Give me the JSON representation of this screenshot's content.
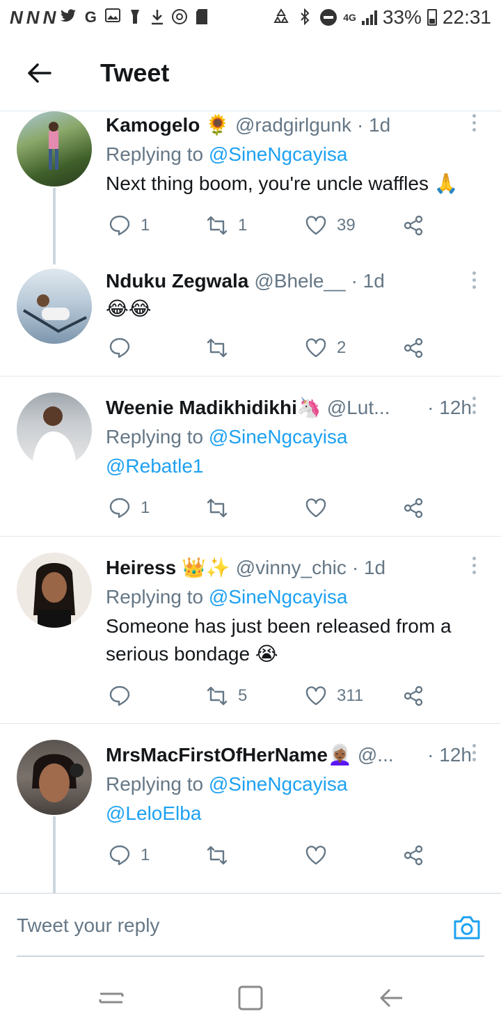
{
  "status_bar": {
    "left_glyphs": [
      "N",
      "N",
      "N"
    ],
    "network": "4G",
    "battery": "33%",
    "time": "22:31"
  },
  "header": {
    "title": "Tweet"
  },
  "tweets": [
    {
      "name": "Kamogelo 🌻",
      "handle": "@radgirlgunk",
      "time": "· 1d",
      "replying_label": "Replying to",
      "replying_to": "@SineNgcayisa",
      "text": "Next thing boom, you're uncle waffles 🙏",
      "replies": "1",
      "retweets": "1",
      "likes": "39"
    },
    {
      "name": "Nduku Zegwala",
      "handle": "@Bhele__",
      "time": "· 1d",
      "text": "😂😂",
      "replies": "",
      "retweets": "",
      "likes": "2"
    },
    {
      "name": "Weenie Madikhidikhi🦄",
      "handle": "@Lut...",
      "time": "· 12h",
      "replying_label": "Replying to",
      "replying_to": "@SineNgcayisa",
      "text": "@Rebatle1",
      "replies": "1",
      "retweets": "",
      "likes": ""
    },
    {
      "name": "Heiress 👑✨",
      "handle": "@vinny_chic",
      "time": "· 1d",
      "replying_label": "Replying to",
      "replying_to": "@SineNgcayisa",
      "text_line1": "Someone has just been released from a",
      "text_line2": "serious bondage 😭",
      "replies": "",
      "retweets": "5",
      "likes": "311"
    },
    {
      "name": "MrsMacFirstOfHerName👩🏾‍🦳",
      "handle": "@...",
      "time": "· 12h",
      "replying_label": "Replying to",
      "replying_to": "@SineNgcayisa",
      "text": "@LeloElba",
      "replies": "1",
      "retweets": "",
      "likes": ""
    }
  ],
  "reply_bar": {
    "placeholder": "Tweet your reply"
  },
  "icons": {
    "accent": "#1da1f2",
    "muted": "#657786",
    "divider": "#e1e8ed"
  }
}
